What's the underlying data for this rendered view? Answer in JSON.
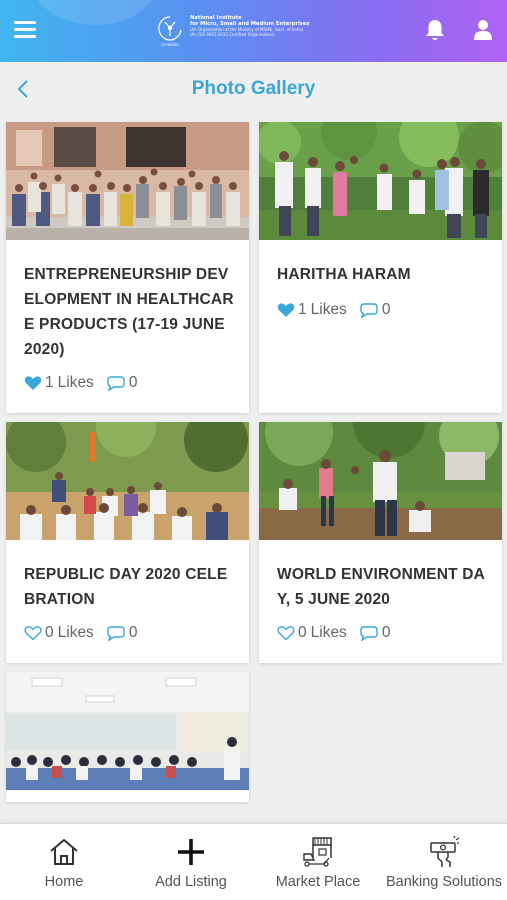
{
  "header": {
    "logo": {
      "mark_text": "ni-msme",
      "line1": "National Institute",
      "line2": "for Micro, Small and Medium Enterprises",
      "line3": "(An Organisation of the Ministry of MSME, Govt. of India)",
      "line4": "(An ISO 9001:2015 Certified Organisation)"
    },
    "icons": [
      "menu-icon",
      "bell-icon",
      "user-icon"
    ]
  },
  "page": {
    "title": "Photo Gallery",
    "back_icon": "chevron-left-icon"
  },
  "gallery": [
    {
      "title": "ENTREPRENEURSHIP DEVELOPMENT IN HEALTHCARE PRODUCTS (17-19 JUNE 2020)",
      "likes": "1",
      "likes_label": "Likes",
      "comments": "0",
      "liked": true
    },
    {
      "title": "HARITHA HARAM",
      "likes": "1",
      "likes_label": "Likes",
      "comments": "0",
      "liked": true
    },
    {
      "title": "REPUBLIC DAY 2020 CELEBRATION",
      "likes": "0",
      "likes_label": "Likes",
      "comments": "0",
      "liked": false
    },
    {
      "title": "WORLD ENVIRONMENT DAY, 5 JUNE 2020",
      "likes": "0",
      "likes_label": "Likes",
      "comments": "0",
      "liked": false
    },
    {
      "title": "",
      "likes": "",
      "likes_label": "",
      "comments": ""
    }
  ],
  "bottom_nav": [
    {
      "label": "Home",
      "icon": "home-icon"
    },
    {
      "label": "Add Listing",
      "icon": "plus-icon"
    },
    {
      "label": "Market Place",
      "icon": "market-place-icon"
    },
    {
      "label": "Banking Solutions",
      "icon": "banking-icon"
    }
  ],
  "colors": {
    "accent": "#3aa7d8",
    "heart": "#3aa7d8",
    "header_start": "#3fb6ef",
    "header_end": "#b062f3"
  }
}
